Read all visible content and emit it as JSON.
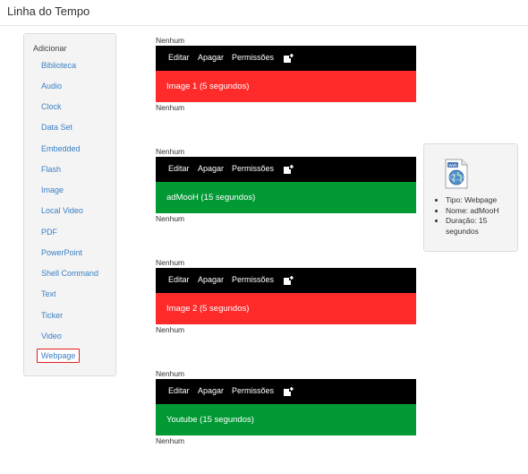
{
  "header": {
    "title": "Linha do Tempo"
  },
  "sidebar": {
    "heading": "Adicionar",
    "items": [
      {
        "label": "Biblioteca"
      },
      {
        "label": "Audio"
      },
      {
        "label": "Clock"
      },
      {
        "label": "Data Set"
      },
      {
        "label": "Embedded"
      },
      {
        "label": "Flash"
      },
      {
        "label": "Image"
      },
      {
        "label": "Local Video"
      },
      {
        "label": "PDF"
      },
      {
        "label": "PowerPoint"
      },
      {
        "label": "Shell Command"
      },
      {
        "label": "Text"
      },
      {
        "label": "Ticker"
      },
      {
        "label": "Video"
      },
      {
        "label": "Webpage",
        "selected": true
      }
    ]
  },
  "toolbar": {
    "edit": "Editar",
    "delete": "Apagar",
    "permissions": "Permissões",
    "add_icon": "plus-icon"
  },
  "regions": [
    {
      "top_label": "Nenhum",
      "media": "Image 1 (5 segundos)",
      "color": "#ff2b2b",
      "bottom_label": "Nenhum"
    },
    {
      "top_label": "Nenhum",
      "media": "adMooH (15 segundos)",
      "color": "#009933",
      "bottom_label": "Nenhum"
    },
    {
      "top_label": "Nenhum",
      "media": "Image 2 (5 segundos)",
      "color": "#ff2b2b",
      "bottom_label": "Nenhum"
    },
    {
      "top_label": "Nenhum",
      "media": "Youtube (15 segundos)",
      "color": "#009933",
      "bottom_label": "Nenhum"
    }
  ],
  "info": {
    "icon": "web-icon",
    "type": "Tipo: Webpage",
    "name": "Nome: adMooH",
    "duration": "Duração: 15 segundos"
  }
}
